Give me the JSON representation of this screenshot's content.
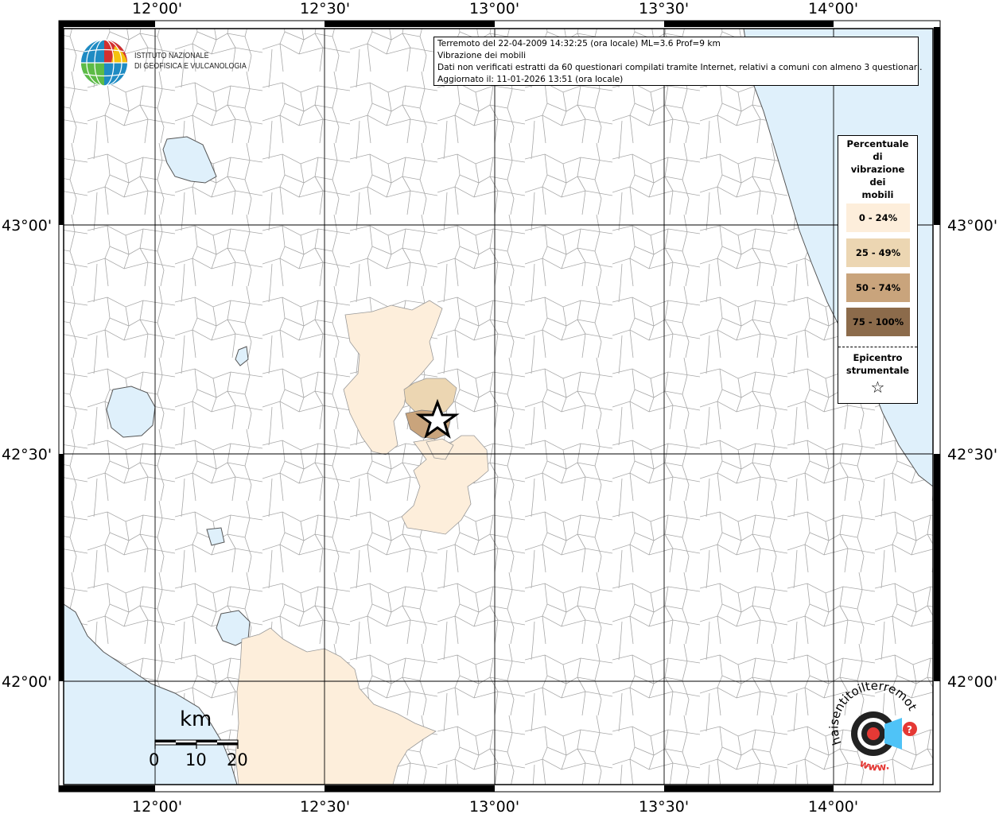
{
  "header": {
    "line1": "Terremoto del 22-04-2009 14:32:25 (ora locale) ML=3.6 Prof=9 km",
    "line2": "Vibrazione dei mobili",
    "line3": "Dati non verificati estratti da 60 questionari compilati tramite Internet, relativi a comuni con almeno 3 questionari.",
    "line4": "Aggiornato il: 11-01-2026 13:51 (ora locale)"
  },
  "ingv": {
    "line1": "ISTITUTO NAZIONALE",
    "line2": "DI GEOFISICA E VULCANOLOGIA"
  },
  "axes": {
    "lon_labels": [
      "12°00'",
      "12°30'",
      "13°00'",
      "13°30'",
      "14°00'"
    ],
    "lat_labels": [
      "43°00'",
      "42°30'",
      "42°00'"
    ]
  },
  "legend": {
    "title_lines": [
      "Percentuale",
      "di",
      "vibrazione",
      "dei",
      "mobili"
    ],
    "classes": [
      {
        "label": "0 - 24%",
        "color": "#fdeedb"
      },
      {
        "label": "25 - 49%",
        "color": "#ecd6b2"
      },
      {
        "label": "50 - 74%",
        "color": "#c9a47c"
      },
      {
        "label": "75 - 100%",
        "color": "#8c6b4b"
      }
    ],
    "epicenter_line1": "Epicentro",
    "epicenter_line2": "strumentale",
    "epicenter_symbol": "☆"
  },
  "scale": {
    "unit": "km",
    "ticks": [
      "0",
      "10",
      "20"
    ]
  },
  "badge": {
    "text_main": "haisentitoilterremoto.it",
    "text_www": "www."
  },
  "colors": {
    "sea": "#dff0fb",
    "grid": "#000000",
    "boundary": "#9a9a9a",
    "border": "#000000"
  }
}
